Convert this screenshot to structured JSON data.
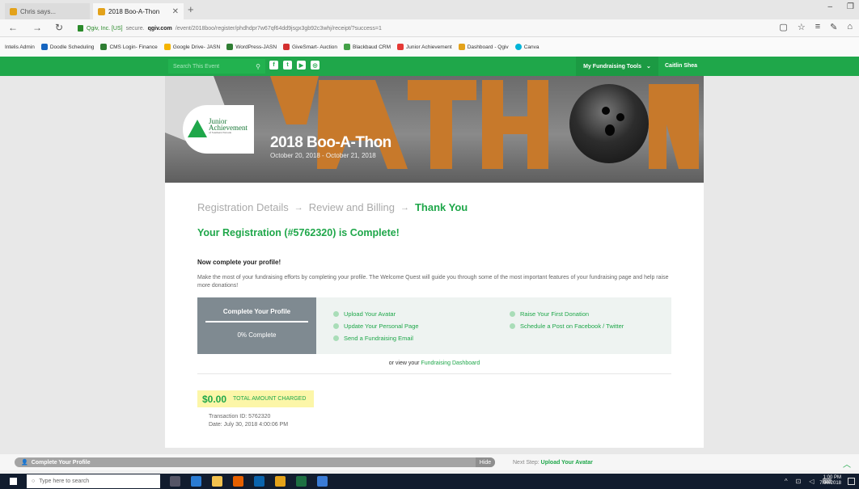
{
  "browser": {
    "tabs": [
      {
        "label": "Chris says...",
        "icon": "star-favicon",
        "color": "#e3a21a"
      },
      {
        "label": "2018 Boo-A-Thon",
        "icon": "qgiv-favicon",
        "color": "#e3a21a"
      }
    ],
    "url": {
      "org": "Qgiv, Inc. [US]",
      "prefix": "secure.",
      "domain": "qgiv.com",
      "path": "/event/2018boo/register/phdhdpr7w67qf64dd9jsgx3gb92c3whj/receipt/?success=1"
    },
    "bookmarks": [
      "Intelis Admin",
      "Doodle Scheduling",
      "CMS Login- Finance",
      "Google Drive- JASN",
      "WordPress-JASN",
      "GiveSmart- Auction",
      "Blackbaud CRM",
      "Junior Achievement",
      "Dashboard - Qgiv",
      "Canva"
    ]
  },
  "sitenav": {
    "search_placeholder": "Search This Event",
    "tools_label": "My Fundraising Tools",
    "user_name": "Caitlin Shea",
    "brand_green": "#1fa74a"
  },
  "banner": {
    "logo_line1": "Junior",
    "logo_line2": "Achievement",
    "logo_sub": "of Southern Nevada",
    "title": "2018 Boo-A-Thon",
    "dates": "October 20, 2018 - October 21, 2018"
  },
  "steps": [
    "Registration Details",
    "Review and Billing",
    "Thank You"
  ],
  "confirmation": {
    "heading": "Your Registration (#5762320) is Complete!",
    "subheading": "Now complete your profile!",
    "description": "Make the most of your fundraising efforts by completing your profile. The Welcome Quest will guide you through some of the most important features of your fundraising page and help raise more donations!"
  },
  "profile": {
    "title": "Complete Your Profile",
    "progress_label": "0% Complete",
    "progress": 0,
    "tasks": [
      "Upload Your Avatar",
      "Update Your Personal Page",
      "Send a Fundraising Email",
      "Raise Your First Donation",
      "Schedule a Post on Facebook / Twitter"
    ],
    "or_view": "or view your",
    "dashboard_link": "Fundraising Dashboard"
  },
  "receipt": {
    "amount": "$0.00",
    "amount_label": "TOTAL AMOUNT CHARGED",
    "transaction": "Transaction ID: 5762320",
    "date": "Date: July 30, 2018 4:00:06 PM"
  },
  "questbar": {
    "label": "Complete Your Profile",
    "hide": "Hide",
    "next_prefix": "Next Step:",
    "next_step": "Upload Your Avatar"
  },
  "taskbar": {
    "search_placeholder": "Type here to search",
    "time": "1:00 PM",
    "date": "7/30/2018"
  }
}
